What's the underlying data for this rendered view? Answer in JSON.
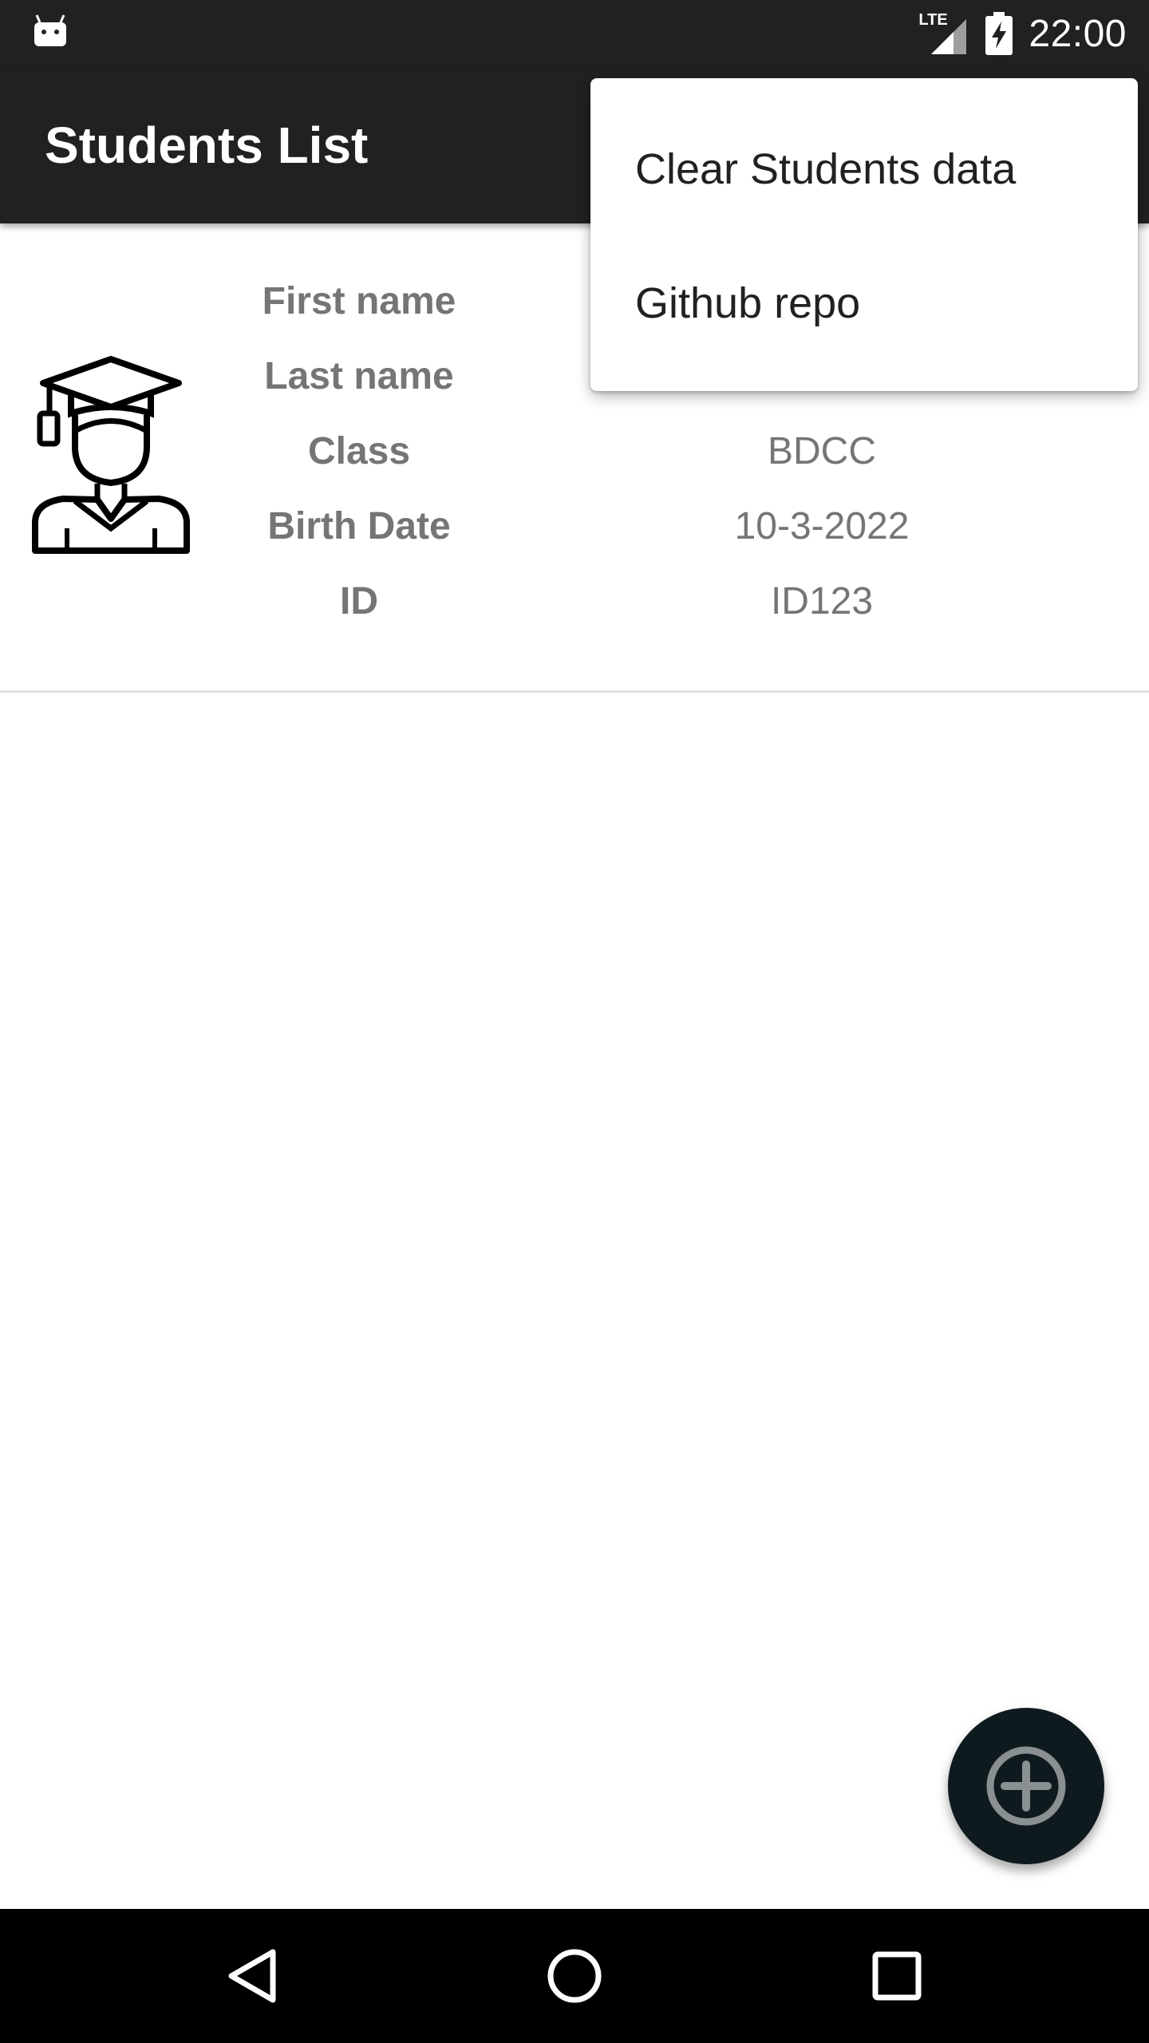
{
  "status_bar": {
    "time": "22:00",
    "network_label": "LTE",
    "icons": [
      "android-notification-icon",
      "lte-signal-icon",
      "battery-charging-icon"
    ]
  },
  "app_bar": {
    "title": "Students List"
  },
  "student": {
    "fields": [
      {
        "label": "First name",
        "value": ""
      },
      {
        "label": "Last name",
        "value": ""
      },
      {
        "label": "Class",
        "value": "BDCC"
      },
      {
        "label": "Birth Date",
        "value": "10-3-2022"
      },
      {
        "label": "ID",
        "value": "ID123"
      }
    ],
    "avatar_icon": "graduate-student-icon"
  },
  "menu": {
    "items": [
      {
        "label": "Clear Students data"
      },
      {
        "label": "Github repo"
      }
    ]
  },
  "fab": {
    "icon": "add-circle-icon"
  },
  "navigation": {
    "icons": [
      "back-icon",
      "home-icon",
      "recents-icon"
    ]
  },
  "colors": {
    "app_bar": "#212121",
    "label_text": "#757575",
    "fab": "#0f1a1f",
    "nav_bar": "#000000"
  }
}
